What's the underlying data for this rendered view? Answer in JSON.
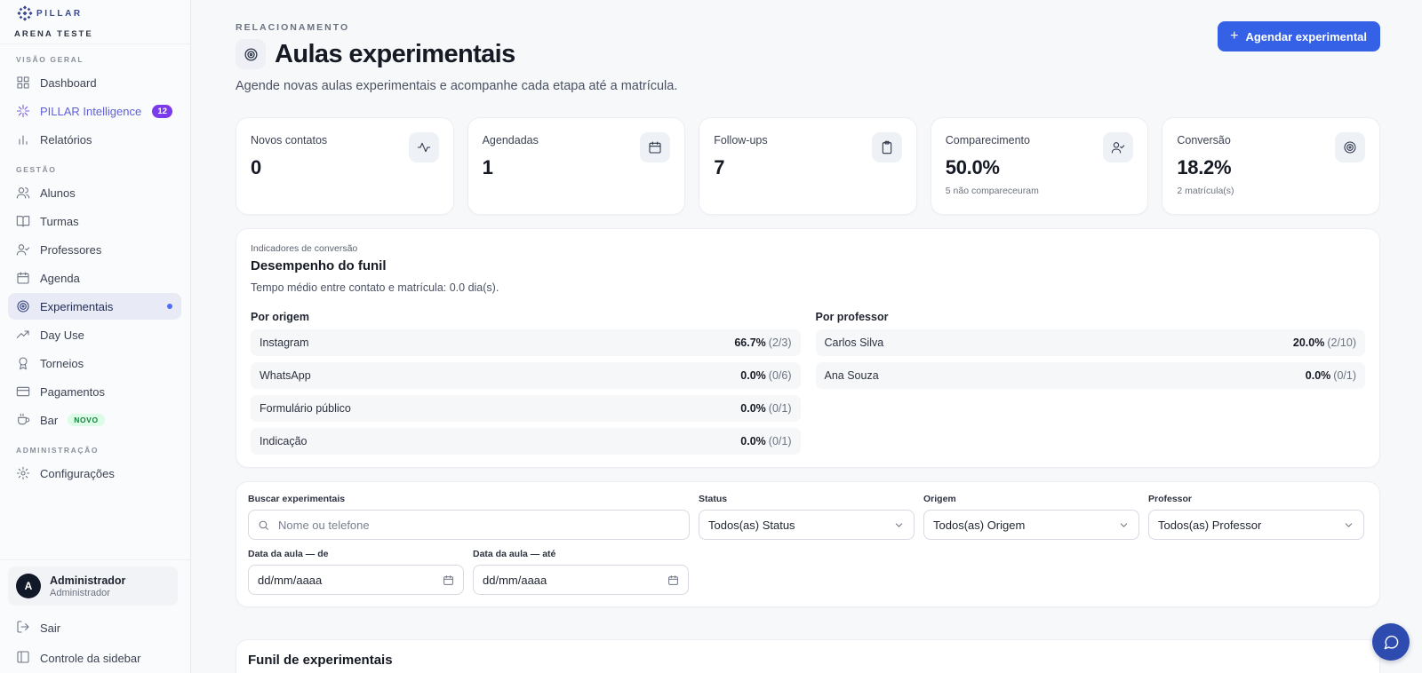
{
  "brand": {
    "logo_text": "PILLAR",
    "org_name": "ARENA TESTE"
  },
  "sidebar": {
    "sections": {
      "overview": "VISÃO GERAL",
      "management": "GESTÃO",
      "admin": "ADMINISTRAÇÃO"
    },
    "items": [
      {
        "label": "Dashboard",
        "icon": "grid-icon"
      },
      {
        "label": "PILLAR Intelligence",
        "icon": "sparkle-icon",
        "badge": "12"
      },
      {
        "label": "Relatórios",
        "icon": "bar-chart-icon"
      },
      {
        "label": "Alunos",
        "icon": "users-icon"
      },
      {
        "label": "Turmas",
        "icon": "book-icon"
      },
      {
        "label": "Professores",
        "icon": "user-check-icon"
      },
      {
        "label": "Agenda",
        "icon": "calendar-icon"
      },
      {
        "label": "Experimentais",
        "icon": "target-icon",
        "active": true
      },
      {
        "label": "Day Use",
        "icon": "trending-up-icon"
      },
      {
        "label": "Torneios",
        "icon": "award-icon"
      },
      {
        "label": "Pagamentos",
        "icon": "credit-card-icon"
      },
      {
        "label": "Bar",
        "icon": "coffee-icon",
        "badge": "NOVO"
      },
      {
        "label": "Configurações",
        "icon": "gear-icon"
      }
    ],
    "user": {
      "initial": "A",
      "name": "Administrador",
      "role": "Administrador"
    },
    "logout": "Sair",
    "sidebar_control": "Controle da sidebar"
  },
  "header": {
    "eyebrow": "RELACIONAMENTO",
    "title": "Aulas experimentais",
    "subtitle": "Agende novas aulas experimentais e acompanhe cada etapa até a matrícula.",
    "cta_label": "Agendar experimental"
  },
  "stats": [
    {
      "label": "Novos contatos",
      "value": "0",
      "note": "",
      "icon": "activity-icon"
    },
    {
      "label": "Agendadas",
      "value": "1",
      "note": "",
      "icon": "calendar-icon"
    },
    {
      "label": "Follow-ups",
      "value": "7",
      "note": "",
      "icon": "clipboard-icon"
    },
    {
      "label": "Comparecimento",
      "value": "50.0%",
      "note": "5 não compareceuram",
      "icon": "user-check-icon"
    },
    {
      "label": "Conversão",
      "value": "18.2%",
      "note": "2 matrícula(s)",
      "icon": "target-icon"
    }
  ],
  "funnel": {
    "eyebrow": "Indicadores de conversão",
    "title": "Desempenho do funil",
    "description": "Tempo médio entre contato e matrícula: 0.0 dia(s).",
    "by_origin": {
      "title": "Por origem",
      "rows": [
        {
          "name": "Instagram",
          "pct": "66.7%",
          "frac": "(2/3)"
        },
        {
          "name": "WhatsApp",
          "pct": "0.0%",
          "frac": "(0/6)"
        },
        {
          "name": "Formulário público",
          "pct": "0.0%",
          "frac": "(0/1)"
        },
        {
          "name": "Indicação",
          "pct": "0.0%",
          "frac": "(0/1)"
        }
      ]
    },
    "by_teacher": {
      "title": "Por professor",
      "rows": [
        {
          "name": "Carlos Silva",
          "pct": "20.0%",
          "frac": "(2/10)"
        },
        {
          "name": "Ana Souza",
          "pct": "0.0%",
          "frac": "(0/1)"
        }
      ]
    }
  },
  "filters": {
    "search": {
      "label": "Buscar experimentais",
      "placeholder": "Nome ou telefone"
    },
    "status": {
      "label": "Status",
      "value": "Todos(as) Status"
    },
    "origin": {
      "label": "Origem",
      "value": "Todos(as) Origem"
    },
    "teacher": {
      "label": "Professor",
      "value": "Todos(as) Professor"
    },
    "date_from": {
      "label": "Data da aula — de",
      "value": "dd/mm/aaaa"
    },
    "date_to": {
      "label": "Data da aula — até",
      "value": "dd/mm/aaaa"
    }
  },
  "funnel_table": {
    "title": "Funil de experimentais"
  },
  "colors": {
    "accent": "#3461e6",
    "active_bg": "#e8ebf5",
    "badge_purple": "#7c3aed",
    "badge_new_bg": "#dcfce7"
  }
}
